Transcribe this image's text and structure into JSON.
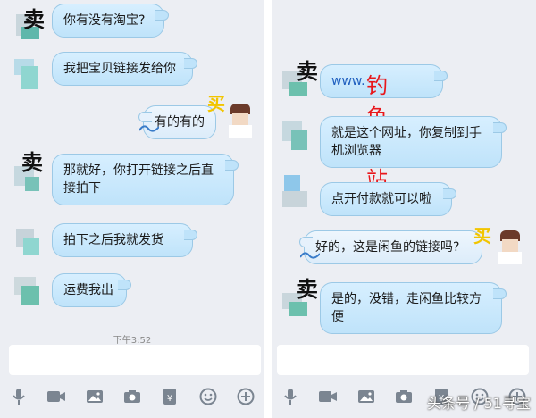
{
  "left": {
    "messages": [
      {
        "side": "in",
        "mark": "卖",
        "text": "你有没有淘宝?"
      },
      {
        "side": "in",
        "mark": "",
        "text": "我把宝贝链接发给你"
      },
      {
        "side": "out",
        "mark": "买",
        "text": "有的有的"
      },
      {
        "side": "in",
        "mark": "卖",
        "text": "那就好，你打开链接之后直接拍下"
      },
      {
        "side": "in",
        "mark": "",
        "text": "拍下之后我就发货"
      },
      {
        "side": "in",
        "mark": "",
        "text": "运费我出"
      }
    ],
    "timestamp": "下午3:52"
  },
  "right": {
    "messages": [
      {
        "side": "in",
        "mark": "卖",
        "text": "www."
      },
      {
        "side": "in",
        "mark": "",
        "text": "就是这个网址，你复制到手机浏览器"
      },
      {
        "side": "in",
        "mark": "",
        "text": "点开付款就可以啦"
      },
      {
        "side": "out",
        "mark": "买",
        "text": "好的，这是闲鱼的链接吗?"
      },
      {
        "side": "in",
        "mark": "卖",
        "text": "是的，没错，走闲鱼比较方便"
      }
    ],
    "overlay": "钓鱼网站"
  },
  "toolbar": {
    "icons": [
      "microphone-icon",
      "video-icon",
      "image-icon",
      "camera-icon",
      "red-packet-icon",
      "emoji-icon",
      "plus-icon"
    ]
  },
  "watermark": "头条号 / 51寻宝",
  "colors": {
    "panel_bg": "#eceef3",
    "bubble_in": "#bfe3fa",
    "bubble_out": "#dcecfa",
    "overlay_red": "#e8171c",
    "buy_mark": "#f2c500"
  }
}
